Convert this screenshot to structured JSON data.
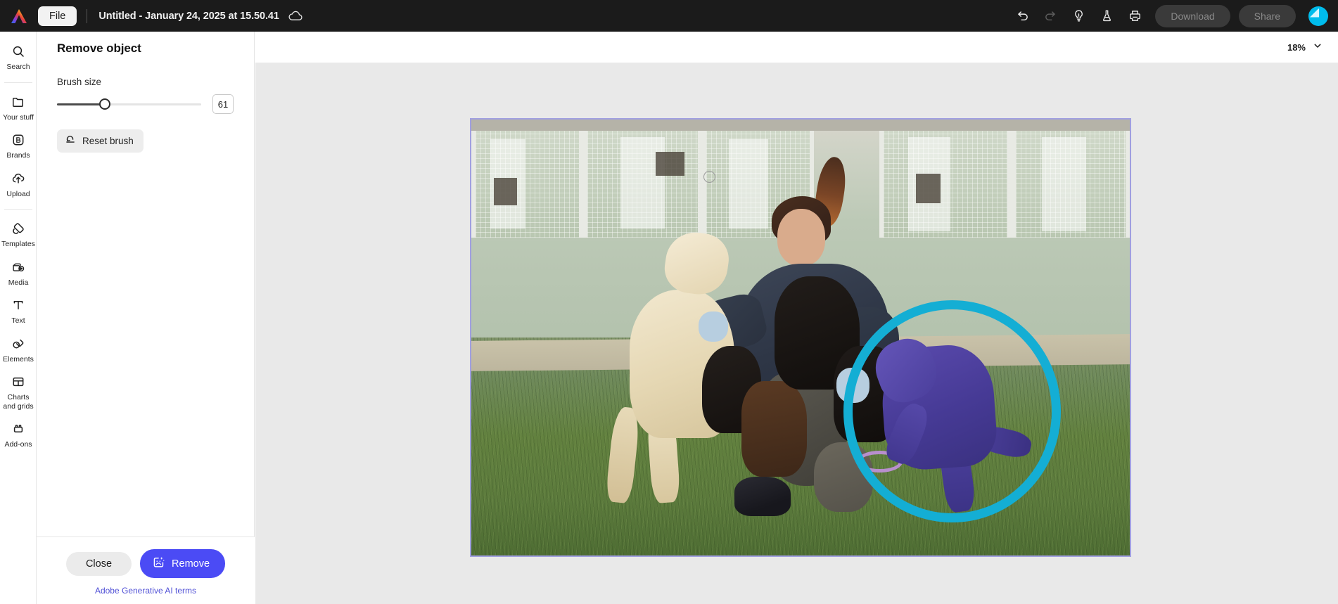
{
  "topbar": {
    "logo_icon": "adobe-express-logo",
    "file_label": "File",
    "doc_title": "Untitled - January 24, 2025 at 15.50.41",
    "cloud_icon": "cloud-saved-icon",
    "undo_icon": "undo-icon",
    "redo_icon": "redo-icon",
    "lightbulb_icon": "lightbulb-icon",
    "flask_icon": "flask-beta-icon",
    "print_icon": "print-icon",
    "download_label": "Download",
    "share_label": "Share",
    "avatar_icon": "user-avatar",
    "bg_color": "#1b1b1b"
  },
  "rail": {
    "items": [
      {
        "label": "Search",
        "icon": "search-icon",
        "name": "search"
      },
      {
        "label": "Your stuff",
        "icon": "folder-icon",
        "name": "your-stuff"
      },
      {
        "label": "Brands",
        "icon": "brands-b-icon",
        "name": "brands"
      },
      {
        "label": "Upload",
        "icon": "upload-cloud-icon",
        "name": "upload"
      },
      {
        "label": "Templates",
        "icon": "templates-icon",
        "name": "templates"
      },
      {
        "label": "Media",
        "icon": "media-play-icon",
        "name": "media"
      },
      {
        "label": "Text",
        "icon": "text-t-icon",
        "name": "text"
      },
      {
        "label": "Elements",
        "icon": "elements-shapes-icon",
        "name": "elements"
      },
      {
        "label": "Charts and grids",
        "icon": "charts-grids-icon",
        "name": "charts-and-grids"
      },
      {
        "label": "Add-ons",
        "icon": "addons-icon",
        "name": "add-ons"
      }
    ]
  },
  "panel": {
    "title": "Remove object",
    "brush_size_label": "Brush size",
    "brush_size_value": "61",
    "reset_brush_label": "Reset brush",
    "reset_brush_icon": "reset-brush-icon",
    "close_label": "Close",
    "remove_label": "Remove",
    "remove_icon": "generative-ai-sparkle-icon",
    "terms_label": "Adobe Generative AI terms",
    "accent_color": "#4b4bf5",
    "terms_color": "#5050d6"
  },
  "canvas": {
    "zoom_value": "18%",
    "zoom_chevron_icon": "chevron-down-icon",
    "background_color": "#e9e9e9",
    "selection_border_color": "#a09fe0",
    "brush_stroke_color": "#14aed4",
    "mask_color": "#463a95",
    "brush_cursor_icon": "brush-cursor-circle",
    "image_alt": "Woman crouching on grass with several puppies in front of an animal shelter kennel"
  }
}
